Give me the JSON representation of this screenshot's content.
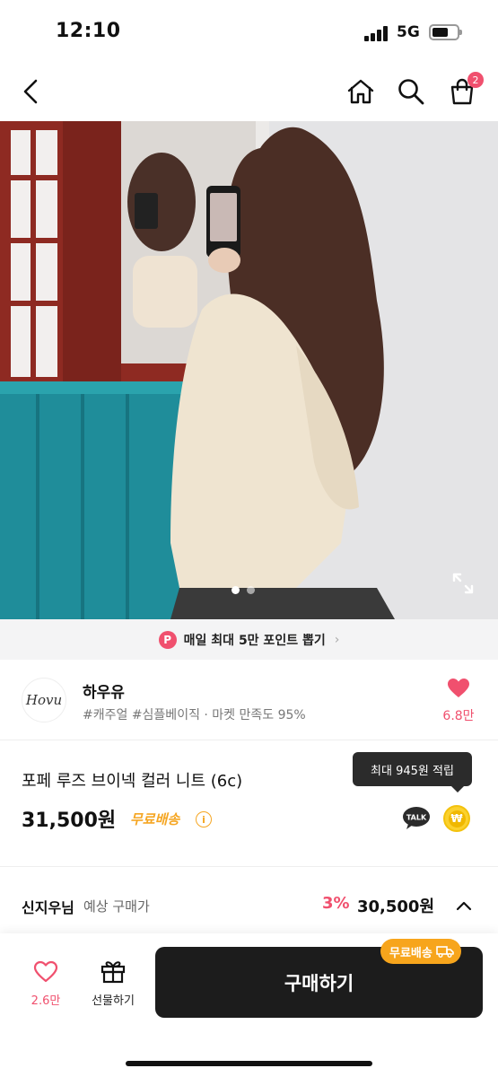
{
  "status_bar": {
    "time": "12:10",
    "network": "5G"
  },
  "nav": {
    "cart_count": "2"
  },
  "promo": {
    "badge": "P",
    "text": "매일 최대 5만 포인트 뽑기",
    "chevron": "›"
  },
  "store": {
    "logo_text": "Hovu",
    "name": "하우유",
    "tags": "#캐주얼 #심플베이직 · 마켓 만족도 95%",
    "like_count": "6.8만"
  },
  "product": {
    "title": "포페 루즈 브이넥 컬러 니트 (6c)",
    "price": "31,500원",
    "free_shipping": "무료배송",
    "tooltip": "최대 945원 적립",
    "talk_label": "TALK",
    "won_symbol": "₩"
  },
  "expected_price": {
    "user_name": "신지우님",
    "label": "예상 구매가",
    "discount": "3%",
    "price": "30,500원"
  },
  "bottom_bar": {
    "like_count": "2.6만",
    "gift_label": "선물하기",
    "buy_label": "구매하기",
    "free_badge": "무료배송"
  },
  "carousel": {
    "total": 2,
    "current": 1
  },
  "colors": {
    "accent": "#f0506e",
    "shipping": "#f5a623",
    "buy": "#1c1c1c"
  }
}
